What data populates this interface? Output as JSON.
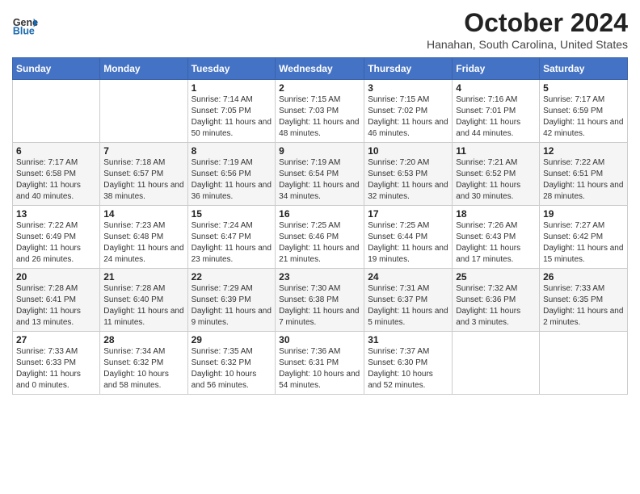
{
  "header": {
    "logo": {
      "general": "General",
      "blue": "Blue"
    },
    "title": "October 2024",
    "location": "Hanahan, South Carolina, United States"
  },
  "days_of_week": [
    "Sunday",
    "Monday",
    "Tuesday",
    "Wednesday",
    "Thursday",
    "Friday",
    "Saturday"
  ],
  "weeks": [
    [
      {
        "num": "",
        "sunrise": "",
        "sunset": "",
        "daylight": ""
      },
      {
        "num": "",
        "sunrise": "",
        "sunset": "",
        "daylight": ""
      },
      {
        "num": "1",
        "sunrise": "Sunrise: 7:14 AM",
        "sunset": "Sunset: 7:05 PM",
        "daylight": "Daylight: 11 hours and 50 minutes."
      },
      {
        "num": "2",
        "sunrise": "Sunrise: 7:15 AM",
        "sunset": "Sunset: 7:03 PM",
        "daylight": "Daylight: 11 hours and 48 minutes."
      },
      {
        "num": "3",
        "sunrise": "Sunrise: 7:15 AM",
        "sunset": "Sunset: 7:02 PM",
        "daylight": "Daylight: 11 hours and 46 minutes."
      },
      {
        "num": "4",
        "sunrise": "Sunrise: 7:16 AM",
        "sunset": "Sunset: 7:01 PM",
        "daylight": "Daylight: 11 hours and 44 minutes."
      },
      {
        "num": "5",
        "sunrise": "Sunrise: 7:17 AM",
        "sunset": "Sunset: 6:59 PM",
        "daylight": "Daylight: 11 hours and 42 minutes."
      }
    ],
    [
      {
        "num": "6",
        "sunrise": "Sunrise: 7:17 AM",
        "sunset": "Sunset: 6:58 PM",
        "daylight": "Daylight: 11 hours and 40 minutes."
      },
      {
        "num": "7",
        "sunrise": "Sunrise: 7:18 AM",
        "sunset": "Sunset: 6:57 PM",
        "daylight": "Daylight: 11 hours and 38 minutes."
      },
      {
        "num": "8",
        "sunrise": "Sunrise: 7:19 AM",
        "sunset": "Sunset: 6:56 PM",
        "daylight": "Daylight: 11 hours and 36 minutes."
      },
      {
        "num": "9",
        "sunrise": "Sunrise: 7:19 AM",
        "sunset": "Sunset: 6:54 PM",
        "daylight": "Daylight: 11 hours and 34 minutes."
      },
      {
        "num": "10",
        "sunrise": "Sunrise: 7:20 AM",
        "sunset": "Sunset: 6:53 PM",
        "daylight": "Daylight: 11 hours and 32 minutes."
      },
      {
        "num": "11",
        "sunrise": "Sunrise: 7:21 AM",
        "sunset": "Sunset: 6:52 PM",
        "daylight": "Daylight: 11 hours and 30 minutes."
      },
      {
        "num": "12",
        "sunrise": "Sunrise: 7:22 AM",
        "sunset": "Sunset: 6:51 PM",
        "daylight": "Daylight: 11 hours and 28 minutes."
      }
    ],
    [
      {
        "num": "13",
        "sunrise": "Sunrise: 7:22 AM",
        "sunset": "Sunset: 6:49 PM",
        "daylight": "Daylight: 11 hours and 26 minutes."
      },
      {
        "num": "14",
        "sunrise": "Sunrise: 7:23 AM",
        "sunset": "Sunset: 6:48 PM",
        "daylight": "Daylight: 11 hours and 24 minutes."
      },
      {
        "num": "15",
        "sunrise": "Sunrise: 7:24 AM",
        "sunset": "Sunset: 6:47 PM",
        "daylight": "Daylight: 11 hours and 23 minutes."
      },
      {
        "num": "16",
        "sunrise": "Sunrise: 7:25 AM",
        "sunset": "Sunset: 6:46 PM",
        "daylight": "Daylight: 11 hours and 21 minutes."
      },
      {
        "num": "17",
        "sunrise": "Sunrise: 7:25 AM",
        "sunset": "Sunset: 6:44 PM",
        "daylight": "Daylight: 11 hours and 19 minutes."
      },
      {
        "num": "18",
        "sunrise": "Sunrise: 7:26 AM",
        "sunset": "Sunset: 6:43 PM",
        "daylight": "Daylight: 11 hours and 17 minutes."
      },
      {
        "num": "19",
        "sunrise": "Sunrise: 7:27 AM",
        "sunset": "Sunset: 6:42 PM",
        "daylight": "Daylight: 11 hours and 15 minutes."
      }
    ],
    [
      {
        "num": "20",
        "sunrise": "Sunrise: 7:28 AM",
        "sunset": "Sunset: 6:41 PM",
        "daylight": "Daylight: 11 hours and 13 minutes."
      },
      {
        "num": "21",
        "sunrise": "Sunrise: 7:28 AM",
        "sunset": "Sunset: 6:40 PM",
        "daylight": "Daylight: 11 hours and 11 minutes."
      },
      {
        "num": "22",
        "sunrise": "Sunrise: 7:29 AM",
        "sunset": "Sunset: 6:39 PM",
        "daylight": "Daylight: 11 hours and 9 minutes."
      },
      {
        "num": "23",
        "sunrise": "Sunrise: 7:30 AM",
        "sunset": "Sunset: 6:38 PM",
        "daylight": "Daylight: 11 hours and 7 minutes."
      },
      {
        "num": "24",
        "sunrise": "Sunrise: 7:31 AM",
        "sunset": "Sunset: 6:37 PM",
        "daylight": "Daylight: 11 hours and 5 minutes."
      },
      {
        "num": "25",
        "sunrise": "Sunrise: 7:32 AM",
        "sunset": "Sunset: 6:36 PM",
        "daylight": "Daylight: 11 hours and 3 minutes."
      },
      {
        "num": "26",
        "sunrise": "Sunrise: 7:33 AM",
        "sunset": "Sunset: 6:35 PM",
        "daylight": "Daylight: 11 hours and 2 minutes."
      }
    ],
    [
      {
        "num": "27",
        "sunrise": "Sunrise: 7:33 AM",
        "sunset": "Sunset: 6:33 PM",
        "daylight": "Daylight: 11 hours and 0 minutes."
      },
      {
        "num": "28",
        "sunrise": "Sunrise: 7:34 AM",
        "sunset": "Sunset: 6:32 PM",
        "daylight": "Daylight: 10 hours and 58 minutes."
      },
      {
        "num": "29",
        "sunrise": "Sunrise: 7:35 AM",
        "sunset": "Sunset: 6:32 PM",
        "daylight": "Daylight: 10 hours and 56 minutes."
      },
      {
        "num": "30",
        "sunrise": "Sunrise: 7:36 AM",
        "sunset": "Sunset: 6:31 PM",
        "daylight": "Daylight: 10 hours and 54 minutes."
      },
      {
        "num": "31",
        "sunrise": "Sunrise: 7:37 AM",
        "sunset": "Sunset: 6:30 PM",
        "daylight": "Daylight: 10 hours and 52 minutes."
      },
      {
        "num": "",
        "sunrise": "",
        "sunset": "",
        "daylight": ""
      },
      {
        "num": "",
        "sunrise": "",
        "sunset": "",
        "daylight": ""
      }
    ]
  ]
}
